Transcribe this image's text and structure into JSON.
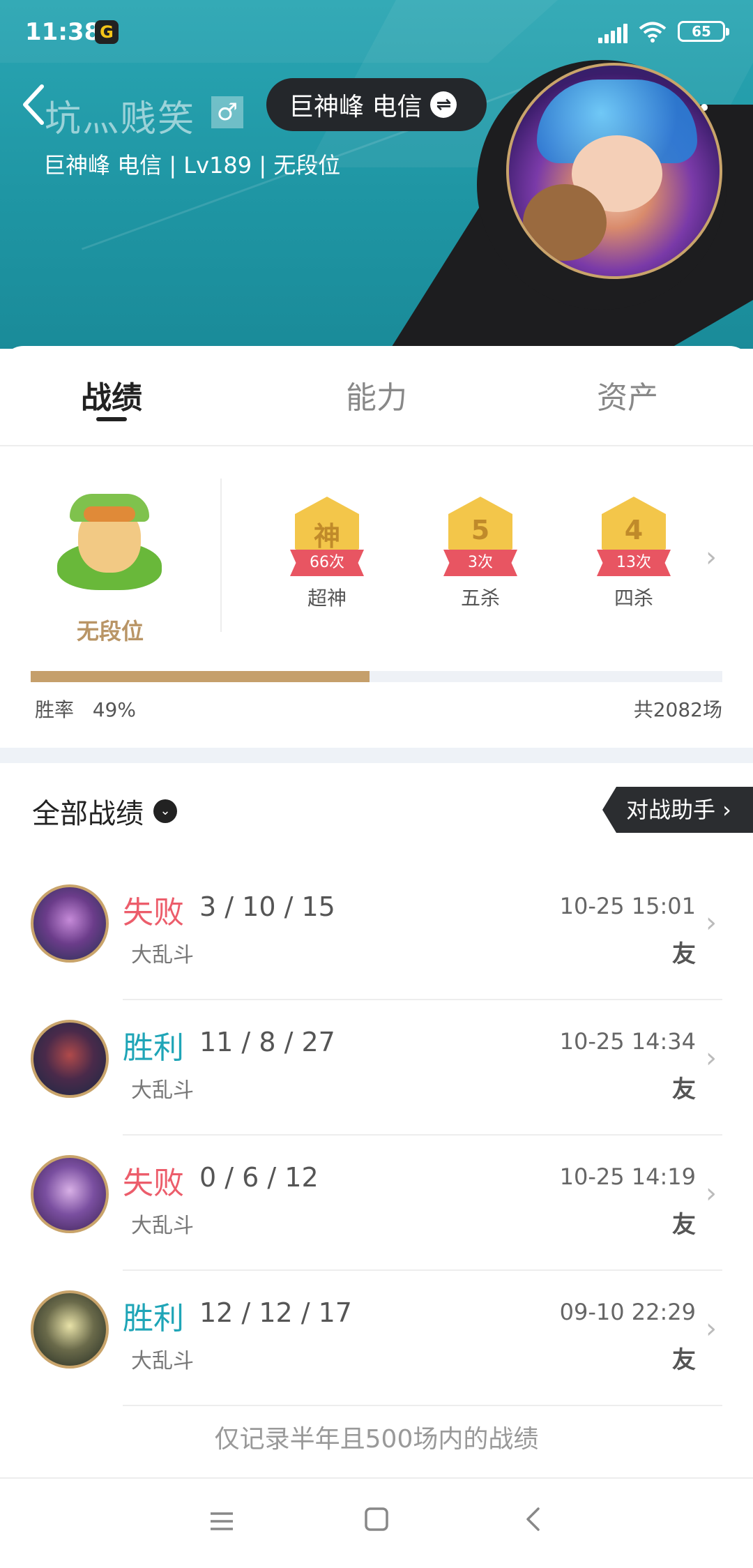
{
  "status_bar": {
    "time": "11:38",
    "battery": "65"
  },
  "profile": {
    "name": "坑灬贱笑",
    "gender_symbol": "♂",
    "server_button": "巨神峰 电信",
    "swap_symbol": "⇌",
    "subinfo": "巨神峰 电信 | Lv189 | 无段位"
  },
  "tabs": [
    "战绩",
    "能力",
    "资产"
  ],
  "rank": {
    "label": "无段位"
  },
  "medals": [
    {
      "glyph": "神",
      "count": "66次",
      "name": "超神"
    },
    {
      "glyph": "5",
      "count": "3次",
      "name": "五杀"
    },
    {
      "glyph": "4",
      "count": "13次",
      "name": "四杀"
    }
  ],
  "stats": {
    "win_rate_label": "胜率",
    "win_rate_value": "49%",
    "win_rate_fraction": 0.49,
    "total_games": "共2082场"
  },
  "filter": {
    "label": "全部战绩",
    "dropdown_symbol": "⌄"
  },
  "assistant_button": "对战助手 ›",
  "matches": [
    {
      "result": "失败",
      "kind": "lose",
      "kda": "3 / 10 / 15",
      "mode": "大乱斗",
      "time": "10-25 15:01",
      "tag": "友"
    },
    {
      "result": "胜利",
      "kind": "win",
      "kda": "11 / 8 / 27",
      "mode": "大乱斗",
      "time": "10-25 14:34",
      "tag": "友"
    },
    {
      "result": "失败",
      "kind": "lose",
      "kda": "0 / 6 / 12",
      "mode": "大乱斗",
      "time": "10-25 14:19",
      "tag": "友"
    },
    {
      "result": "胜利",
      "kind": "win",
      "kda": "12 / 12 / 17",
      "mode": "大乱斗",
      "time": "09-10 22:29",
      "tag": "友"
    }
  ],
  "footer_note": "仅记录半年且500场内的战绩",
  "icons": {
    "back": "chevron-left-icon",
    "more": "more-icon",
    "menu": "menu-icon",
    "home": "home-icon",
    "nav_back": "back-icon"
  },
  "colors": {
    "header_teal": "#2aa6b3",
    "lose": "#ec5d6b",
    "win": "#1fa5b7",
    "rank_gold": "#b99566",
    "progress": "#c59f6b"
  }
}
